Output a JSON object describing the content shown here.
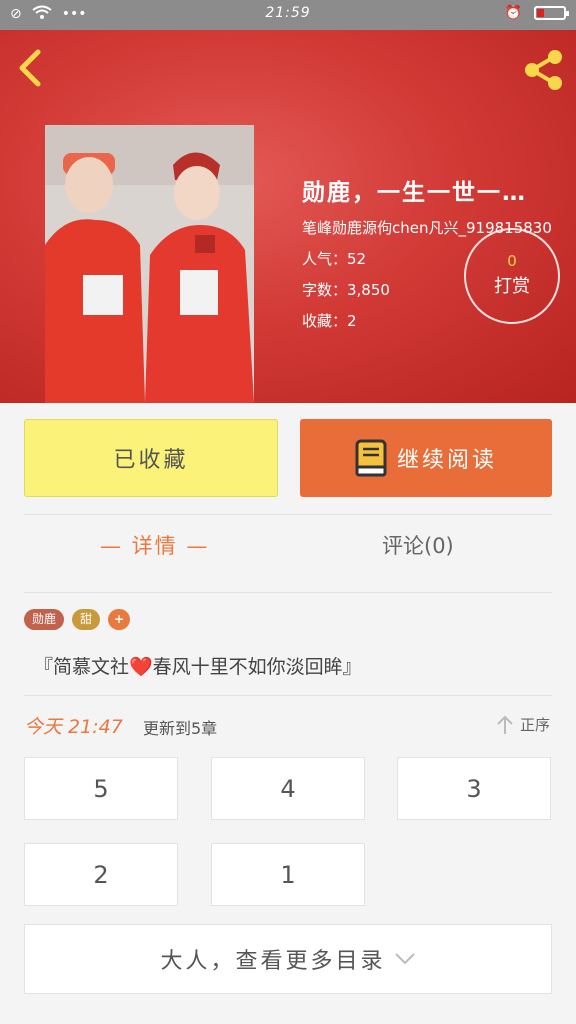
{
  "status_bar": {
    "time": "21:59"
  },
  "book": {
    "title": "勋鹿，一生一世一…",
    "author": "笔峰勋鹿源佝chen凡兴_919815830",
    "popularity": "人气：52",
    "word_count": "字数：3,850",
    "favorites": "收藏：2",
    "tip_count": "0",
    "tip_label": "打赏"
  },
  "actions": {
    "collect_label": "已收藏",
    "continue_label": "继续阅读"
  },
  "tabs": {
    "details": "— 详情 —",
    "comments": "评论(0)"
  },
  "tags": [
    "勋鹿",
    "甜",
    "+"
  ],
  "summary": "『简慕文社❤️春风十里不如你淡回眸』",
  "update": {
    "time": "今天 21:47",
    "text": "更新到5章",
    "sort_label": "正序"
  },
  "chapters": [
    "5",
    "4",
    "3",
    "2",
    "1"
  ],
  "more_label": "大人，查看更多目录",
  "colors": {
    "accent": "#e8793f",
    "collect_bg": "#fbf27a",
    "hero_red": "#d23a36"
  }
}
